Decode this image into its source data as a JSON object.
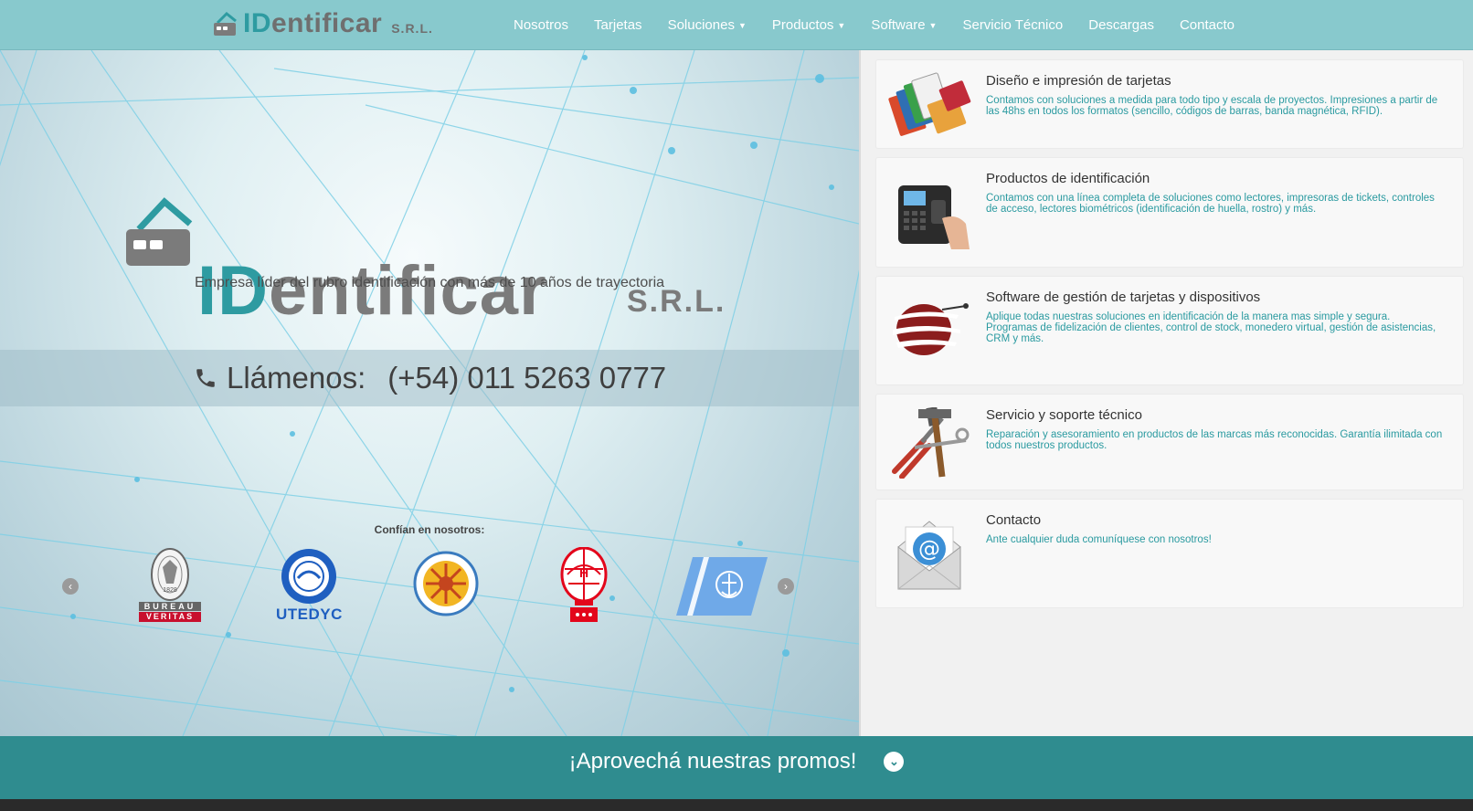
{
  "nav": {
    "logo_id": "ID",
    "logo_rest": "entificar",
    "logo_srl": "S.R.L.",
    "items": [
      {
        "label": "Nosotros",
        "dropdown": false
      },
      {
        "label": "Tarjetas",
        "dropdown": false
      },
      {
        "label": "Soluciones",
        "dropdown": true
      },
      {
        "label": "Productos",
        "dropdown": true
      },
      {
        "label": "Software",
        "dropdown": true
      },
      {
        "label": "Servicio Técnico",
        "dropdown": false
      },
      {
        "label": "Descargas",
        "dropdown": false
      },
      {
        "label": "Contacto",
        "dropdown": false
      }
    ],
    "caret_glyph": "▼"
  },
  "hero": {
    "logo_id": "ID",
    "logo_rest": "entificar",
    "logo_srl": "S.R.L.",
    "tagline": "Empresa líder del rubro identificación con más de 10 años de trayectoria",
    "call_label": "Llámenos:",
    "call_number": "(+54) 011 5263 0777",
    "phone_icon": "phone-icon",
    "trust_title": "Confían en nosotros:",
    "clients": [
      {
        "name": "bureau-veritas-logo",
        "lines": [
          "BUREAU",
          "VERITAS"
        ],
        "year": "1828"
      },
      {
        "name": "utedyc-logo",
        "text": "UTEDYC"
      },
      {
        "name": "seal-logo"
      },
      {
        "name": "huracan-logo",
        "letter": "H"
      },
      {
        "name": "prefectura-logo"
      }
    ],
    "prev_glyph": "‹",
    "next_glyph": "›"
  },
  "cards": [
    {
      "title": "Diseño e impresión de tarjetas",
      "desc": "Contamos con soluciones a medida para todo tipo y escala de proyectos. Impresiones a partir de las 48hs en todos los formatos (sencillo, códigos de barras, banda magnética, RFID).",
      "icon": "cards-image"
    },
    {
      "title": "Productos de identificación",
      "desc": "Contamos con una línea completa de soluciones como lectores, impresoras de tickets, controles de acceso, lectores biométricos (identificación de huella, rostro) y más.",
      "icon": "biometric-reader-image"
    },
    {
      "title": "Software de gestión de tarjetas y dispositivos",
      "desc": "Aplique todas nuestras soluciones en identificación de la manera mas simple y segura. Programas de fidelización de clientes, control de stock, monedero virtual, gestión de asistencias, CRM y más.",
      "icon": "software-sphere-image"
    },
    {
      "title": "Servicio y soporte técnico",
      "desc": "Reparación y asesoramiento en productos de las marcas más reconocidas. Garantía ilimitada con todos nuestros productos.",
      "icon": "tools-image"
    },
    {
      "title": "Contacto",
      "desc": "Ante cualquier duda comuníquese con nosotros!",
      "icon": "email-envelope-image"
    }
  ],
  "promo": {
    "text": "¡Aprovechá nuestras promos!",
    "icon": "chevron-down-icon",
    "glyph": "⌄"
  },
  "colors": {
    "nav_bg": "#88c9cd",
    "teal": "#2e9ba1",
    "promo_bg": "#2f8c8f",
    "card_text": "#2a9aa0"
  }
}
